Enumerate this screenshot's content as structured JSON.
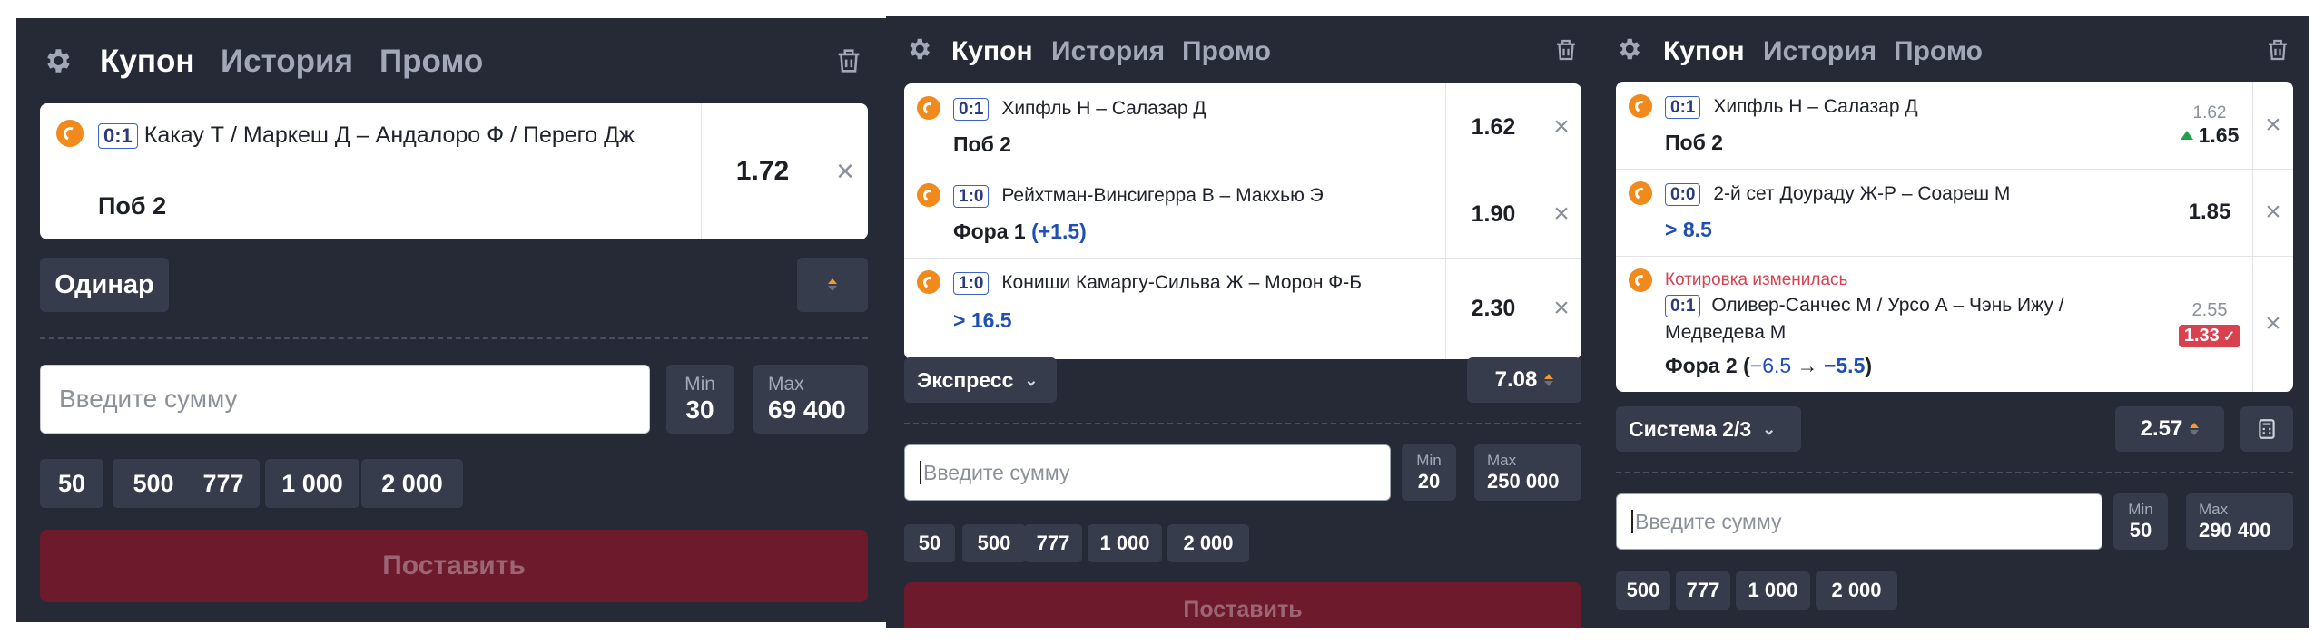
{
  "panel1": {
    "tabs": [
      "Купон",
      "История",
      "Промо"
    ],
    "bet": {
      "score": "0:1",
      "match": "Какау Т / Маркеш Д – Андалоро Ф / Перего Дж",
      "market": "Поб 2",
      "odds": "1.72"
    },
    "bet_type": "Одинар",
    "stake": {
      "placeholder": "Введите сумму",
      "min_label": "Min",
      "min_value": "30",
      "max_label": "Max",
      "max_value": "69 400"
    },
    "quick_amounts": [
      "50",
      "500",
      "777",
      "1 000",
      "2 000"
    ],
    "place_label": "Поставить"
  },
  "panel2": {
    "tabs": [
      "Купон",
      "История",
      "Промо"
    ],
    "bets": [
      {
        "score": "0:1",
        "match": "Хипфль Н – Салазар Д",
        "market": "Поб 2",
        "market_extra": "",
        "odds": "1.62"
      },
      {
        "score": "1:0",
        "match": "Рейхтман-Винсигерра В – Макхью Э",
        "market": "Фора 1 ",
        "market_extra": "(+1.5)",
        "odds": "1.90"
      },
      {
        "score": "1:0",
        "match": "Кониши Камаргу-Сильва Ж – Морон Ф-Б",
        "market": "",
        "market_extra": "> 16.5",
        "odds": "2.30"
      }
    ],
    "bet_type": "Экспресс",
    "total_odds": "7.08",
    "stake": {
      "placeholder": "Введите сумму",
      "min_label": "Min",
      "min_value": "20",
      "max_label": "Max",
      "max_value": "250 000"
    },
    "quick_amounts": [
      "50",
      "500",
      "777",
      "1 000",
      "2 000"
    ],
    "place_label": "Поставить"
  },
  "panel3": {
    "tabs": [
      "Купон",
      "История",
      "Промо"
    ],
    "bets": [
      {
        "score": "0:1",
        "match": "Хипфль Н – Салазар Д",
        "market": "Поб 2",
        "market_extra": "",
        "old_odds": "1.62",
        "odds": "1.65"
      },
      {
        "score": "0:0",
        "match": "2-й сет Доураду Ж-Р – Соареш М",
        "market": "",
        "market_extra": "> 8.5",
        "old_odds": "",
        "odds": "1.85"
      },
      {
        "warning": "Котировка изменилась",
        "score": "0:1",
        "match": "Оливер-Санчес М / Урсо А – Чэнь Ижу / Медведева М",
        "market": "Фора 2 (",
        "market_from": "−6.5",
        "market_arrow": " → ",
        "market_to": "−5.5",
        "market_close": ")",
        "old_odds": "2.55",
        "odds": "1.33"
      }
    ],
    "bet_type": "Система 2/3",
    "total_odds": "2.57",
    "stake": {
      "placeholder": "Введите сумму",
      "min_label": "Min",
      "min_value": "50",
      "max_label": "Max",
      "max_value": "290 400"
    },
    "quick_amounts": [
      "500",
      "777",
      "1 000",
      "2 000"
    ]
  },
  "colors": {
    "panel_bg": "#252a36",
    "pill_bg": "#363c4b",
    "accent_orange": "#f08a1c",
    "place_button": "#6c1a2c",
    "odds_down": "#d9414f",
    "odds_up": "#1ea34a"
  }
}
